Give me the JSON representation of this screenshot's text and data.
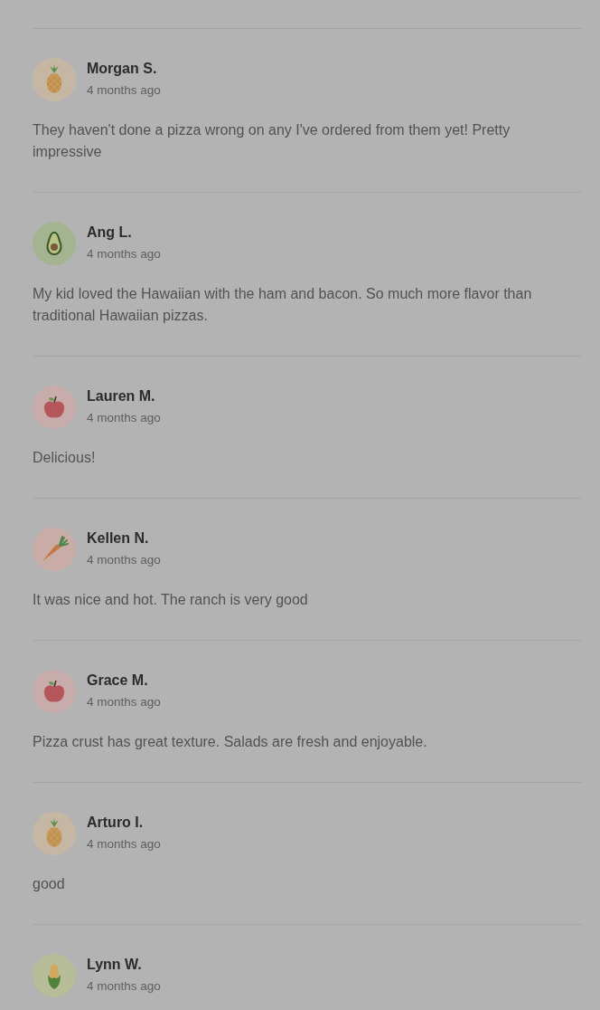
{
  "reviews": [
    {
      "kind": "pineapple",
      "name": "Morgan S.",
      "time": "4 months ago",
      "text": "They haven't done a pizza wrong on any I've ordered from them yet! Pretty impressive"
    },
    {
      "kind": "avocado",
      "name": "Ang L.",
      "time": "4 months ago",
      "text": "My kid loved the Hawaiian with the ham and bacon. So much more flavor than traditional Hawaiian pizzas."
    },
    {
      "kind": "apple",
      "name": "Lauren M.",
      "time": "4 months ago",
      "text": "Delicious!"
    },
    {
      "kind": "carrot",
      "name": "Kellen N.",
      "time": "4 months ago",
      "text": "It was nice and hot. The ranch is very good"
    },
    {
      "kind": "apple",
      "name": "Grace M.",
      "time": "4 months ago",
      "text": "Pizza crust has great texture. Salads are fresh and enjoyable."
    },
    {
      "kind": "pineapple",
      "name": "Arturo I.",
      "time": "4 months ago",
      "text": "good"
    },
    {
      "kind": "corn",
      "name": "Lynn W.",
      "time": "4 months ago"
    }
  ]
}
